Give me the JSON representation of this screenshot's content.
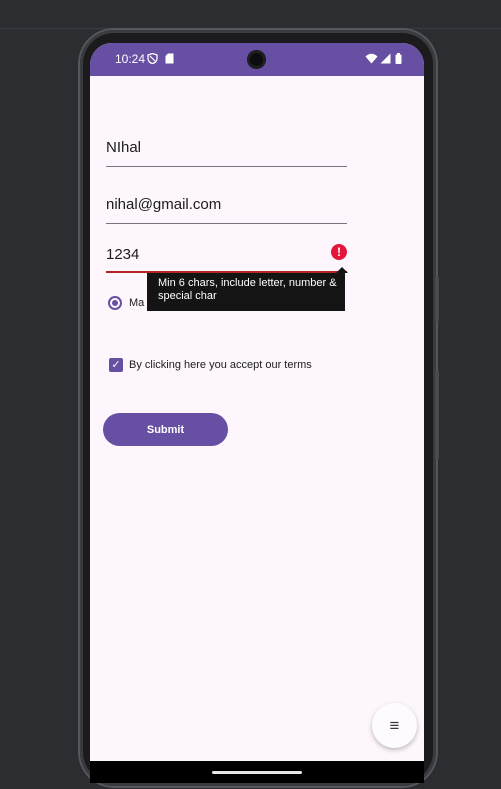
{
  "status_bar": {
    "time": "10:24",
    "icons": [
      "dnd-shield-icon",
      "sd-card-icon",
      "wifi-icon",
      "signal-icon",
      "battery-icon"
    ]
  },
  "form": {
    "name_value": "NIhal",
    "email_value": "nihal@gmail.com",
    "password_value": "1234",
    "password_error": "Min 6 chars, include letter, number & special char",
    "error_icon_glyph": "!",
    "radio_label": "Ma",
    "radio_selected": true,
    "terms_checked": true,
    "terms_label": "By clicking here you accept our terms",
    "checkbox_glyph": "✓",
    "submit_label": "Submit"
  },
  "fab": {
    "glyph": "≡"
  },
  "colors": {
    "primary": "#6750a4",
    "error": "#e3173a",
    "background": "#fdf7fd"
  }
}
